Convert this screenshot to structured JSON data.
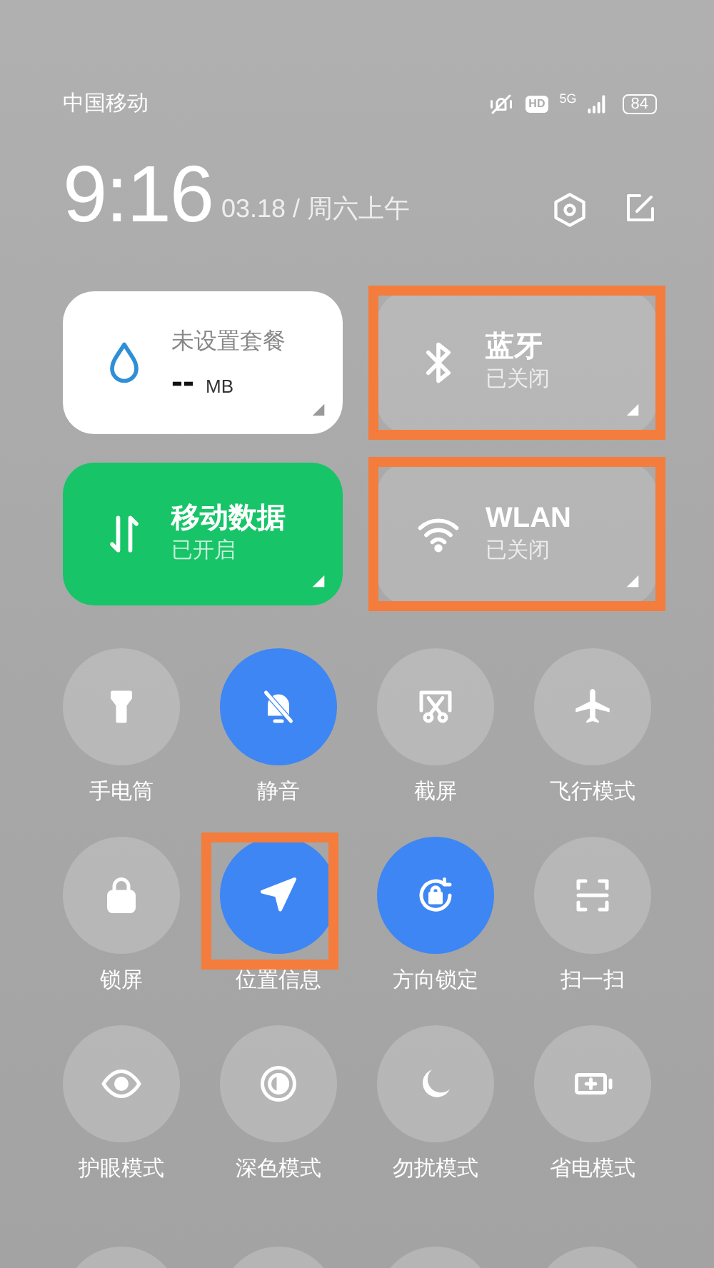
{
  "status_bar": {
    "carrier": "中国移动",
    "hd": "HD",
    "network": "5G",
    "battery": "84"
  },
  "header": {
    "time": "9:16",
    "date": "03.18 / 周六上午"
  },
  "tiles": [
    {
      "kind": "data",
      "title": "未设置套餐",
      "value": "--",
      "unit": "MB",
      "highlighted": false
    },
    {
      "kind": "bluetooth",
      "title": "蓝牙",
      "subtitle": "已关闭",
      "on": false,
      "highlighted": true
    },
    {
      "kind": "mobile-data",
      "title": "移动数据",
      "subtitle": "已开启",
      "on": true,
      "highlighted": false
    },
    {
      "kind": "wlan",
      "title": "WLAN",
      "subtitle": "已关闭",
      "on": false,
      "highlighted": true
    }
  ],
  "toggles": [
    {
      "kind": "flashlight",
      "label": "手电筒",
      "on": false,
      "highlighted": false
    },
    {
      "kind": "mute",
      "label": "静音",
      "on": true,
      "highlighted": false
    },
    {
      "kind": "screenshot",
      "label": "截屏",
      "on": false,
      "highlighted": false
    },
    {
      "kind": "airplane",
      "label": "飞行模式",
      "on": false,
      "highlighted": false
    },
    {
      "kind": "lock",
      "label": "锁屏",
      "on": false,
      "highlighted": false
    },
    {
      "kind": "location",
      "label": "位置信息",
      "on": true,
      "highlighted": true
    },
    {
      "kind": "rotation-lock",
      "label": "方向锁定",
      "on": true,
      "highlighted": false
    },
    {
      "kind": "scan",
      "label": "扫一扫",
      "on": false,
      "highlighted": false
    },
    {
      "kind": "eye",
      "label": "护眼模式",
      "on": false,
      "highlighted": false
    },
    {
      "kind": "dark-mode",
      "label": "深色模式",
      "on": false,
      "highlighted": false
    },
    {
      "kind": "moon",
      "label": "勿扰模式",
      "on": false,
      "highlighted": false
    },
    {
      "kind": "battery-saver",
      "label": "省电模式",
      "on": false,
      "highlighted": false
    }
  ]
}
